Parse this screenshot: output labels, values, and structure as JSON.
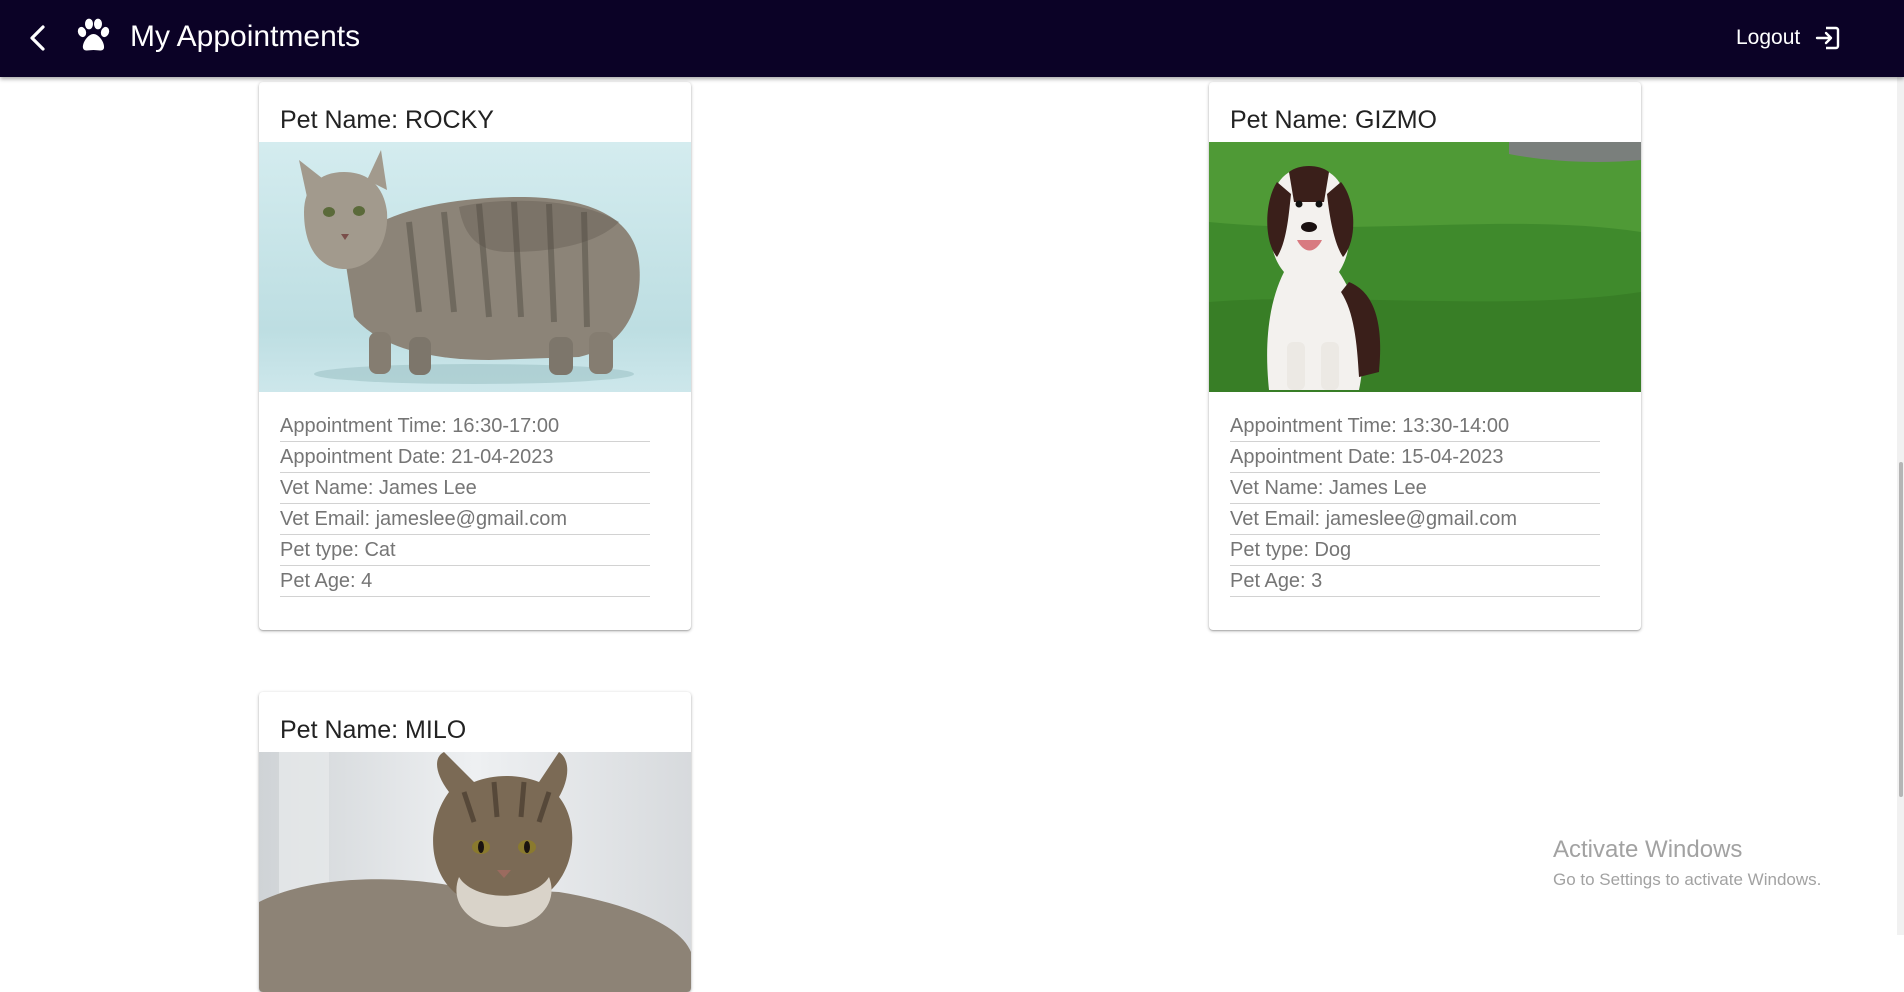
{
  "header": {
    "title": "My Appointments",
    "logout_label": "Logout",
    "bg_color": "#0b0226",
    "icons": [
      "back-arrow-icon",
      "paw-icon",
      "logout-icon"
    ]
  },
  "appointments": [
    {
      "pet_name": "Pet Name: ROCKY",
      "image": "tabby-cat-photo",
      "details": [
        "Appointment Time: 16:30-17:00",
        "Appointment Date: 21-04-2023",
        "Vet Name: James Lee",
        "Vet Email: jameslee@gmail.com",
        "Pet type: Cat",
        "Pet Age: 4"
      ]
    },
    {
      "pet_name": "Pet Name: GIZMO",
      "image": "spaniel-dog-on-grass-photo",
      "details": [
        "Appointment Time: 13:30-14:00",
        "Appointment Date: 15-04-2023",
        "Vet Name: James Lee",
        "Vet Email: jameslee@gmail.com",
        "Pet type: Dog",
        "Pet Age: 3"
      ]
    },
    {
      "pet_name": "Pet Name: MILO",
      "image": "long-haired-tabby-cat-photo",
      "details": []
    }
  ],
  "watermark": {
    "line1": "Activate Windows",
    "line2": "Go to Settings to activate Windows."
  }
}
